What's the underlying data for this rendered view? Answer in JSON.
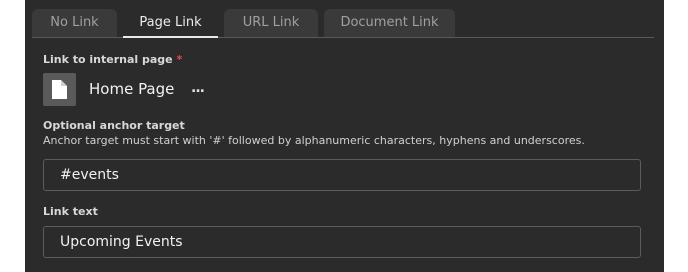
{
  "tabs": [
    {
      "label": "No Link"
    },
    {
      "label": "Page Link"
    },
    {
      "label": "URL Link"
    },
    {
      "label": "Document Link"
    }
  ],
  "internal_page": {
    "label": "Link to internal page",
    "required_mark": "*",
    "selected_page": "Home Page",
    "more_label": "..."
  },
  "anchor": {
    "label": "Optional anchor target",
    "help": "Anchor target must start with '#' followed by alphanumeric characters, hyphens and underscores.",
    "value": "#events"
  },
  "link_text": {
    "label": "Link text",
    "value": "Upcoming Events"
  }
}
